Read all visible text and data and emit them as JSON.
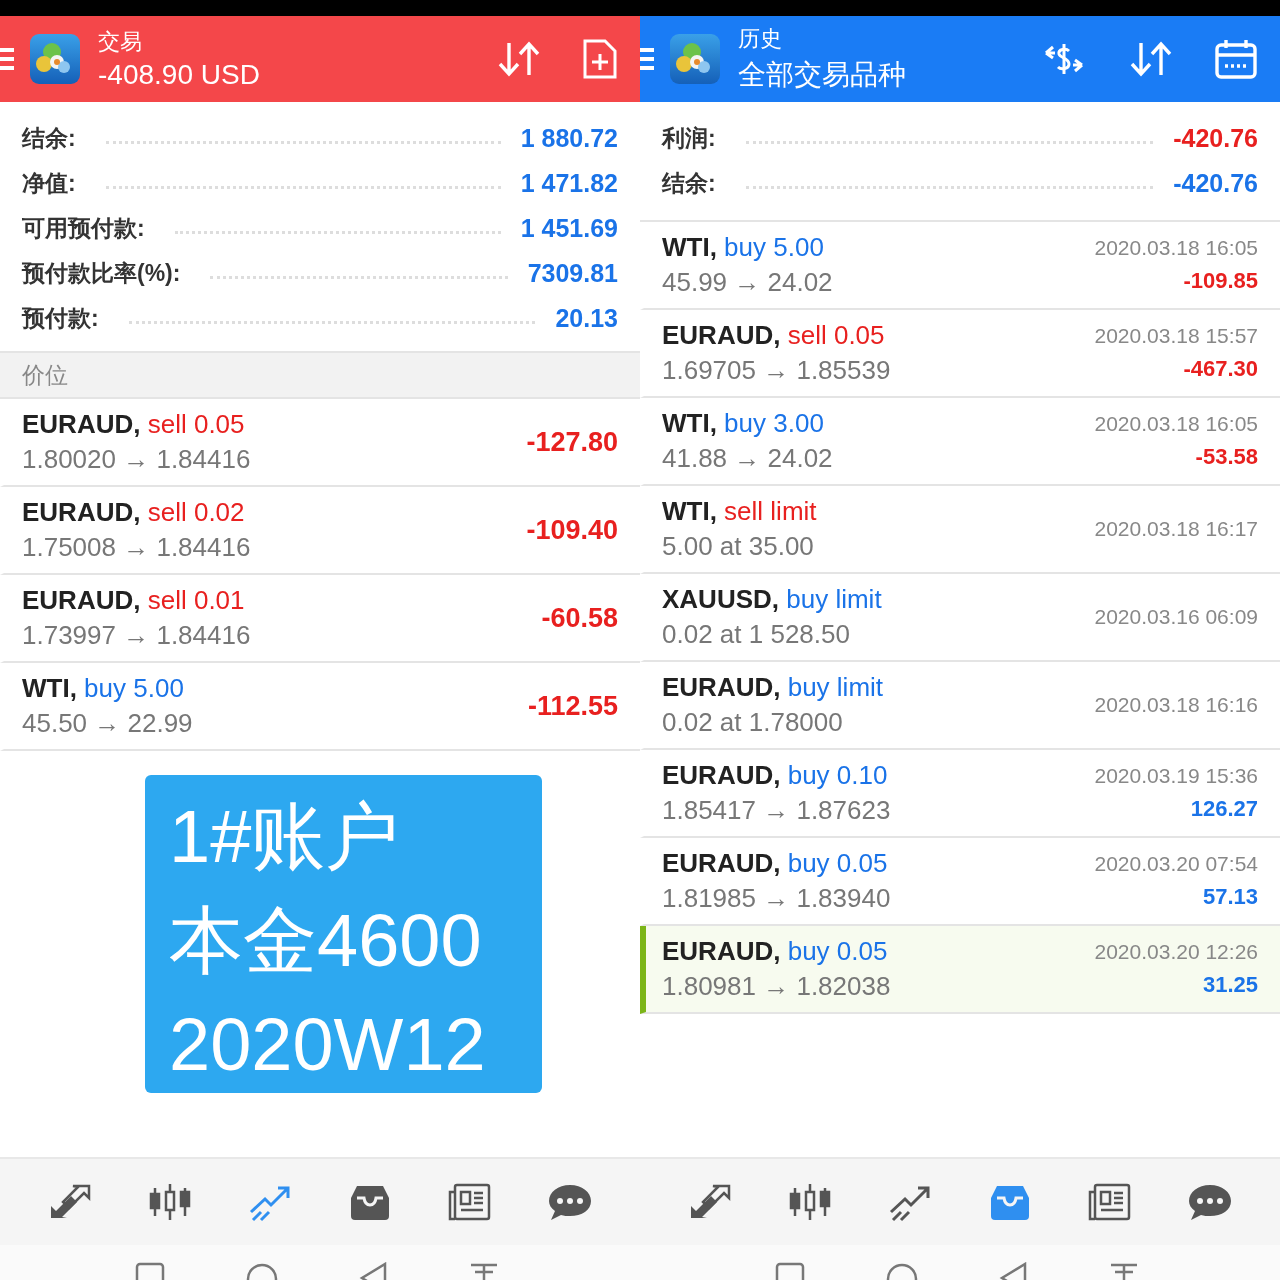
{
  "panels": [
    {
      "header": {
        "title": "交易",
        "subtitle": "-408.90 USD",
        "kind": "trade",
        "color": "#f4474a"
      },
      "summary": [
        {
          "label": "结余:",
          "value": "1 880.72",
          "loss": false
        },
        {
          "label": "净值:",
          "value": "1 471.82",
          "loss": false
        },
        {
          "label": "可用预付款:",
          "value": "1 451.69",
          "loss": false
        },
        {
          "label": "预付款比率(%):",
          "value": "7309.81",
          "loss": false
        },
        {
          "label": "预付款:",
          "value": "20.13",
          "loss": false
        }
      ],
      "section": "价位",
      "rows": [
        {
          "symbol": "EURAUD,",
          "kind": "sell",
          "action": "sell 0.05",
          "detail": "1.80020 → 1.84416",
          "profit": "-127.80",
          "loss": true,
          "selected": false
        },
        {
          "symbol": "EURAUD,",
          "kind": "sell",
          "action": "sell 0.02",
          "detail": "1.75008 → 1.84416",
          "profit": "-109.40",
          "loss": true,
          "selected": false
        },
        {
          "symbol": "EURAUD,",
          "kind": "sell",
          "action": "sell 0.01",
          "detail": "1.73997 → 1.84416",
          "profit": "-60.58",
          "loss": true,
          "selected": false
        },
        {
          "symbol": "WTI,",
          "kind": "buy",
          "action": "buy 5.00",
          "detail": "45.50 → 22.99",
          "profit": "-112.55",
          "loss": true,
          "selected": false
        }
      ],
      "note": [
        "1#账户",
        "本金4600",
        "2020W12"
      ],
      "nav": [
        {
          "selected": false
        },
        {
          "selected": false
        },
        {
          "selected": true
        },
        {
          "selected": false
        },
        {
          "selected": false
        },
        {
          "selected": false
        }
      ]
    },
    {
      "header": {
        "title": "历史",
        "subtitle": "全部交易品种",
        "kind": "history",
        "color": "#1a7cf5"
      },
      "summary": [
        {
          "label": "利润:",
          "value": "-420.76",
          "loss": true
        },
        {
          "label": "结余:",
          "value": "-420.76",
          "loss": false
        }
      ],
      "rows": [
        {
          "symbol": "WTI,",
          "kind": "buy",
          "action": "buy 5.00",
          "detail": "45.99 → 24.02",
          "time": "2020.03.18 16:05",
          "profit": "-109.85",
          "loss": true,
          "selected": false
        },
        {
          "symbol": "EURAUD,",
          "kind": "sell",
          "action": "sell 0.05",
          "detail": "1.69705 → 1.85539",
          "time": "2020.03.18 15:57",
          "profit": "-467.30",
          "loss": true,
          "selected": false
        },
        {
          "symbol": "WTI,",
          "kind": "buy",
          "action": "buy 3.00",
          "detail": "41.88 → 24.02",
          "time": "2020.03.18 16:05",
          "profit": "-53.58",
          "loss": true,
          "selected": false
        },
        {
          "symbol": "WTI,",
          "kind": "sell",
          "action": "sell limit",
          "detail": "5.00 at 35.00",
          "time": "2020.03.18 16:17",
          "selected": false
        },
        {
          "symbol": "XAUUSD,",
          "kind": "buy",
          "action": "buy limit",
          "detail": "0.02 at 1 528.50",
          "time": "2020.03.16 06:09",
          "selected": false
        },
        {
          "symbol": "EURAUD,",
          "kind": "buy",
          "action": "buy limit",
          "detail": "0.02 at 1.78000",
          "time": "2020.03.18 16:16",
          "selected": false
        },
        {
          "symbol": "EURAUD,",
          "kind": "buy",
          "action": "buy 0.10",
          "detail": "1.85417 → 1.87623",
          "time": "2020.03.19 15:36",
          "profit": "126.27",
          "loss": false,
          "selected": false
        },
        {
          "symbol": "EURAUD,",
          "kind": "buy",
          "action": "buy 0.05",
          "detail": "1.81985 → 1.83940",
          "time": "2020.03.20 07:54",
          "profit": "57.13",
          "loss": false,
          "selected": false
        },
        {
          "symbol": "EURAUD,",
          "kind": "buy",
          "action": "buy 0.05",
          "detail": "1.80981 → 1.82038",
          "time": "2020.03.20 12:26",
          "profit": "31.25",
          "loss": false,
          "selected": true
        }
      ],
      "nav": [
        {
          "selected": false
        },
        {
          "selected": false
        },
        {
          "selected": false
        },
        {
          "selected": true
        },
        {
          "selected": false
        },
        {
          "selected": false
        }
      ]
    }
  ]
}
